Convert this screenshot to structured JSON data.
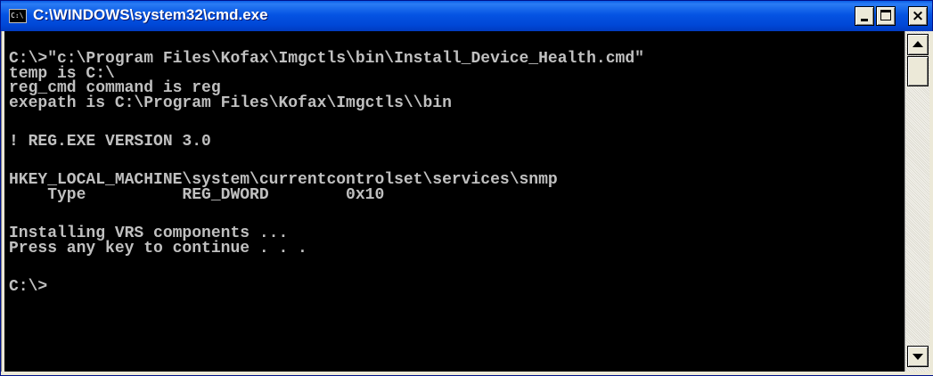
{
  "window": {
    "title": "C:\\WINDOWS\\system32\\cmd.exe",
    "icon_text": "C:\\",
    "icon": "console-icon"
  },
  "console": {
    "lines": [
      "C:\\>\"c:\\Program Files\\Kofax\\Imgctls\\bin\\Install_Device_Health.cmd\"",
      "temp is C:\\",
      "reg_cmd command is reg",
      "exepath is C:\\Program Files\\Kofax\\Imgctls\\\\bin",
      "! REG.EXE VERSION 3.0",
      "HKEY_LOCAL_MACHINE\\system\\currentcontrolset\\services\\snmp",
      "    Type          REG_DWORD        0x10",
      "Installing VRS components ...",
      "Press any key to continue . . .",
      "C:\\>"
    ]
  },
  "colors": {
    "titlebar": "#0054e3",
    "console_background": "#000000",
    "console_text": "#c0c0c0"
  }
}
